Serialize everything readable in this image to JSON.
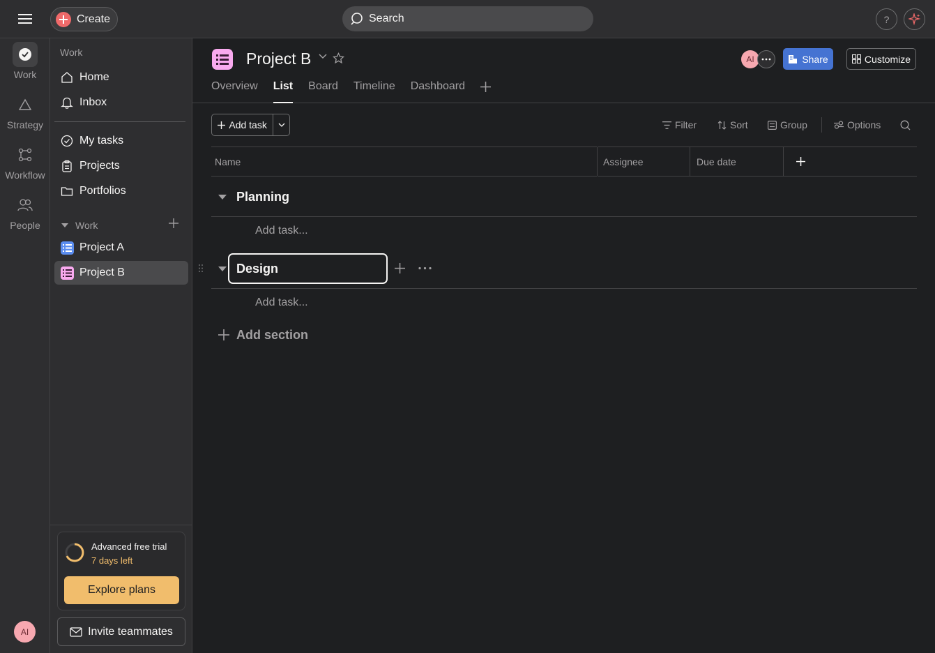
{
  "topbar": {
    "create_label": "Create",
    "search_placeholder": "Search",
    "help_label": "?"
  },
  "rail": {
    "items": [
      {
        "label": "Work",
        "icon": "check-circle-icon"
      },
      {
        "label": "Strategy",
        "icon": "triangle-icon"
      },
      {
        "label": "Workflow",
        "icon": "workflow-icon"
      },
      {
        "label": "People",
        "icon": "people-icon"
      }
    ],
    "avatar_initials": "AI"
  },
  "sidebar": {
    "heading": "Work",
    "top_items": [
      {
        "label": "Home",
        "icon": "home-icon"
      },
      {
        "label": "Inbox",
        "icon": "bell-icon"
      }
    ],
    "mid_items": [
      {
        "label": "My tasks",
        "icon": "check-circle-icon"
      },
      {
        "label": "Projects",
        "icon": "clipboard-icon"
      },
      {
        "label": "Portfolios",
        "icon": "folder-icon"
      }
    ],
    "work_section_label": "Work",
    "projects": [
      {
        "label": "Project A",
        "color": "#5b8def"
      },
      {
        "label": "Project B",
        "color": "#f9aaef"
      }
    ],
    "trial": {
      "title": "Advanced free trial",
      "days_left": "7 days left",
      "explore_label": "Explore plans"
    },
    "invite_label": "Invite teammates"
  },
  "header": {
    "project_title": "Project B",
    "avatar_initials": "AI",
    "share_label": "Share",
    "customize_label": "Customize",
    "tabs": [
      {
        "label": "Overview",
        "active": false
      },
      {
        "label": "List",
        "active": true
      },
      {
        "label": "Board",
        "active": false
      },
      {
        "label": "Timeline",
        "active": false
      },
      {
        "label": "Dashboard",
        "active": false
      }
    ]
  },
  "toolbar": {
    "add_task_label": "Add task",
    "filter_label": "Filter",
    "sort_label": "Sort",
    "group_label": "Group",
    "options_label": "Options"
  },
  "table": {
    "columns": [
      "Name",
      "Assignee",
      "Due date"
    ]
  },
  "sections": [
    {
      "title": "Planning",
      "add_task_placeholder": "Add task..."
    },
    {
      "title": "Design",
      "add_task_placeholder": "Add task..."
    }
  ],
  "add_section_label": "Add section",
  "colors": {
    "accent_blue": "#4573d2",
    "create_red": "#f06a6a",
    "trial_orange": "#f1bd6c",
    "project_b_pink": "#f9aaef",
    "project_a_blue": "#5b8def"
  }
}
